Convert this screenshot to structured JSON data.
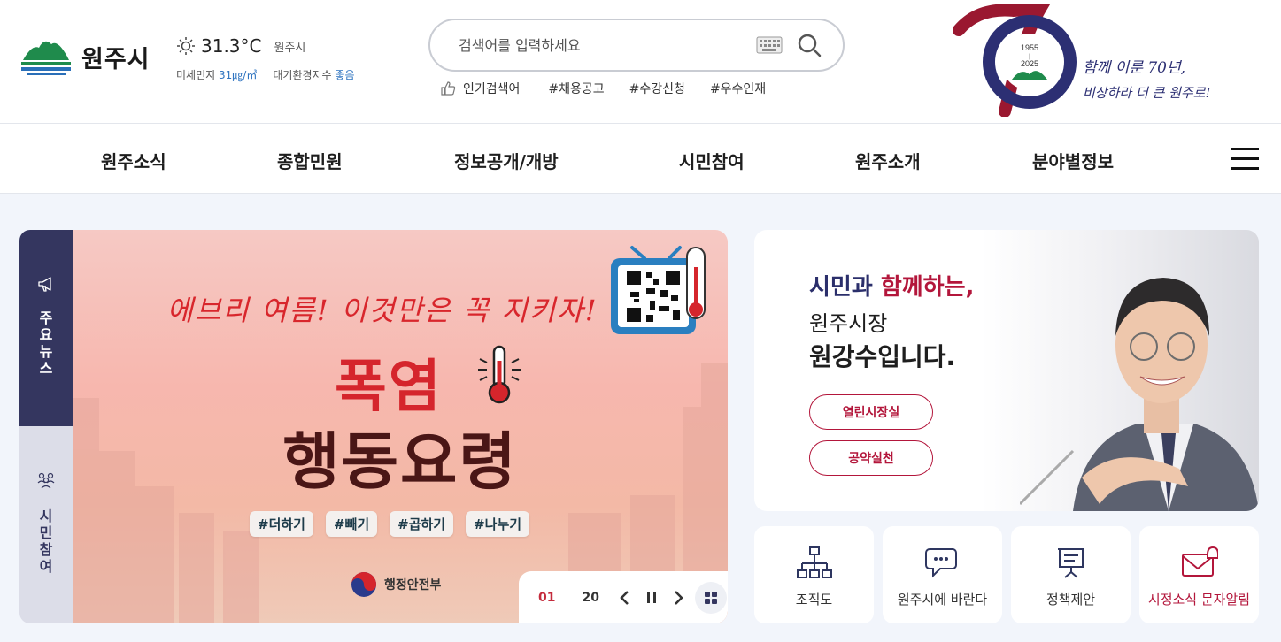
{
  "header": {
    "logo_text": "원주시",
    "weather": {
      "temp": "31.3°C",
      "location": "원주시",
      "dust_label": "미세먼지",
      "dust_value": "31㎍/㎥",
      "air_label": "대기환경지수",
      "air_value": "좋음"
    },
    "search": {
      "placeholder": "검색어를 입력하세요"
    },
    "popular_label": "인기검색어",
    "popular_tags": [
      "#채용공고",
      "#수강신청",
      "#우수인재"
    ],
    "anniversary": {
      "years": "1955 - 2025",
      "year_start": "1955",
      "year_end": "2025",
      "slogan_line1": "함께 이룬 70년,",
      "slogan_line2": "비상하라 더 큰 원주로!"
    }
  },
  "nav": {
    "items": [
      "원주소식",
      "종합민원",
      "정보공개/개방",
      "시민참여",
      "원주소개",
      "분야별정보"
    ]
  },
  "side_tabs": {
    "tab1": "주\n요\n뉴\n스",
    "tab2": "시\n민\n참\n여"
  },
  "banner": {
    "tagline": "에브리 여름! 이것만은 꼭 지키자!",
    "title1": "폭염",
    "title2": "행동요령",
    "hashtags": [
      "#더하기",
      "#빼기",
      "#곱하기",
      "#나누기"
    ],
    "ministry": "행정안전부",
    "pager": {
      "current": "01",
      "total": "20"
    }
  },
  "mayor": {
    "line1_a": "시민과",
    "line1_b": "함께하는,",
    "line2": "원주시장",
    "line3": "원강수입니다.",
    "btn1": "열린시장실",
    "btn2": "공약실천"
  },
  "quick_links": [
    "조직도",
    "원주시에 바란다",
    "정책제안",
    "시정소식 문자알림"
  ],
  "colors": {
    "brand_navy": "#34365f",
    "accent_red": "#b3163b",
    "banner_red": "#d5252c"
  }
}
